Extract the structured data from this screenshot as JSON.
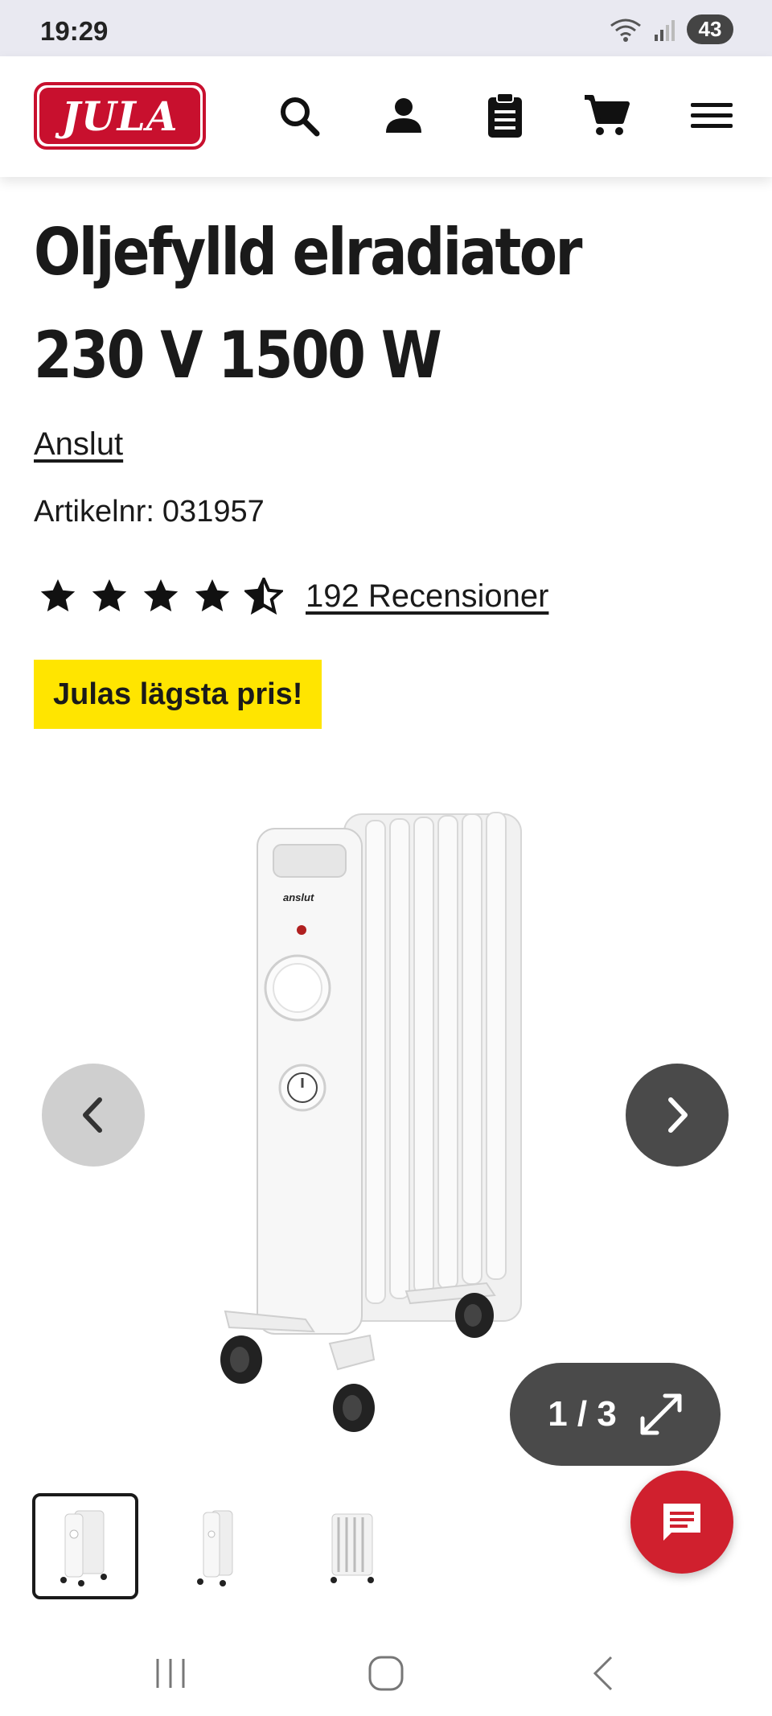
{
  "status_bar": {
    "time": "19:29",
    "battery": "43"
  },
  "header": {
    "logo_text": "JULA",
    "icons": [
      "search-icon",
      "account-icon",
      "shopping-list-icon",
      "cart-icon",
      "menu-icon"
    ]
  },
  "product": {
    "title": "Oljefylld elradiator 230 V 1500 W",
    "brand": "Anslut",
    "article_label": "Artikelnr:",
    "article_number": "031957",
    "rating": 4.5,
    "rating_max": 5,
    "reviews_label": "192 Recensioner",
    "badge": "Julas lägsta pris!"
  },
  "gallery": {
    "counter": "1 / 3",
    "current": 1,
    "total": 3,
    "image_brand_text": "anslut"
  },
  "colors": {
    "brand_red": "#c8102e",
    "badge_yellow": "#ffe500",
    "dark_button": "#4a4a4a"
  }
}
